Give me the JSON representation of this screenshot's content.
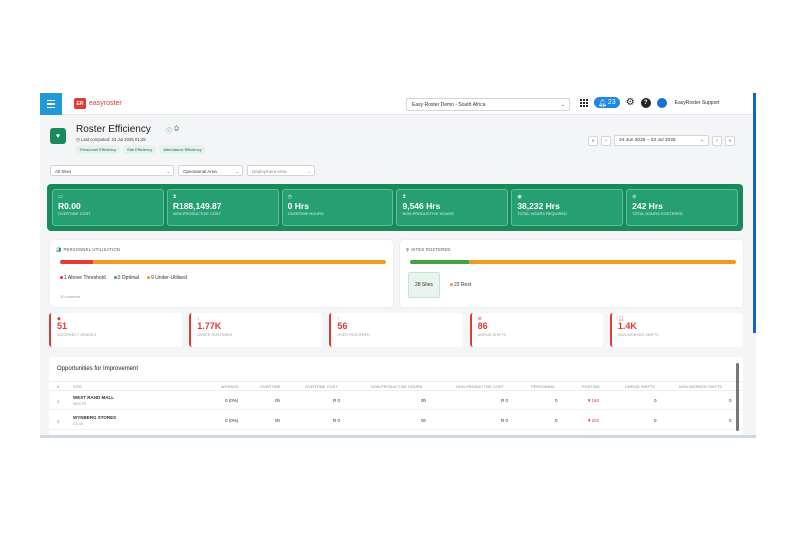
{
  "topbar": {
    "logo_text": "easyroster",
    "org_select": "Easy Roster Demo - South Africa",
    "notifications": "23",
    "user_name": "EasyRoster Support"
  },
  "header": {
    "title": "Roster Efficiency",
    "last_computed": "Last computed: 23 Jul 2025 01:45",
    "chips": [
      "Personnel Efficiency",
      "Site Efficiency",
      "Attendance Efficiency"
    ],
    "date_range": "24 Jun 2025 – 23 Jul 2025"
  },
  "filters": {
    "sites": "All Sites",
    "operational_area": "Operational Area",
    "deployment_area": "Deployment Area"
  },
  "kpis": [
    {
      "icon": "cash-icon",
      "value": "R0.00",
      "label": "OVERTIME COST"
    },
    {
      "icon": "hourglass-icon",
      "value": "R188,149.87",
      "label": "NON-PRODUCTIVE COST"
    },
    {
      "icon": "clock-icon",
      "value": "0 Hrs",
      "label": "OVERTIME HOURS"
    },
    {
      "icon": "hourglass-icon",
      "value": "9,546 Hrs",
      "label": "NON-PRODUCTIVE HOURS"
    },
    {
      "icon": "target-icon",
      "value": "38,232 Hrs",
      "label": "TOTAL HOURS REQUIRED"
    },
    {
      "icon": "check-circle-icon",
      "value": "242 Hrs",
      "label": "TOTAL HOURS ROSTERED"
    }
  ],
  "utilisation": {
    "heading": "PERSONNEL UTILISATION",
    "above_threshold": "1 Above Threshold",
    "optimal": "0 Optimal",
    "under_utilised": "9 Under-Utilised",
    "not_rostered": "10 rostered",
    "bar": {
      "above": 0.1,
      "optimal": 0.0,
      "under": 0.9
    }
  },
  "sites_rostered": {
    "heading": "SITES ROSTERED",
    "rostered": "28 Sites",
    "rest": "22 Rest",
    "bar": {
      "rostered": 0.18,
      "rest": 0.82
    }
  },
  "mini_stats": [
    {
      "value": "51",
      "label": "INCORRECT GRADES"
    },
    {
      "value": "1.77K",
      "label": "UNDER ROSTERED"
    },
    {
      "value": "56",
      "label": "OVER ROSTERED"
    },
    {
      "value": "86",
      "label": "UNPAID SHIFTS"
    },
    {
      "value": "1.4K",
      "label": "NON-WORKED SHIFTS"
    }
  ],
  "opportunities": {
    "title": "Opportunities for Improvement",
    "columns": [
      "#",
      "SITE",
      "WORKED",
      "OVERTIME",
      "OVERTIME COST",
      "NON-PRODUCTIVE HOURS",
      "NON-PRODUCTIVE COST",
      "PERSONNEL",
      "POSTING",
      "UNPAID SHIFTS",
      "NON-WORKED SHIFTS"
    ],
    "rows": [
      {
        "n": "1",
        "site": "WEST RAND MALL",
        "code": "WRCTR",
        "worked": "0 (0%)",
        "overtime": "0h",
        "overtime_cost": "R 0",
        "np_hours": "0h",
        "np_cost": "R 0",
        "personnel": "0",
        "posting": "▼160",
        "unpaid": "0",
        "non_worked": "0"
      },
      {
        "n": "2",
        "site": "WYNBERG STORES",
        "code": "CS-40",
        "worked": "0 (0%)",
        "overtime": "0h",
        "overtime_cost": "R 0",
        "np_hours": "0h",
        "np_cost": "R 0",
        "personnel": "0",
        "posting": "▼202",
        "unpaid": "0",
        "non_worked": "0"
      }
    ]
  },
  "colors": {
    "primary_green": "#1a8a5c",
    "accent_blue": "#1e9bd7",
    "bar_red": "#e53935",
    "bar_orange": "#f39a1e",
    "bar_green": "#43a047"
  }
}
